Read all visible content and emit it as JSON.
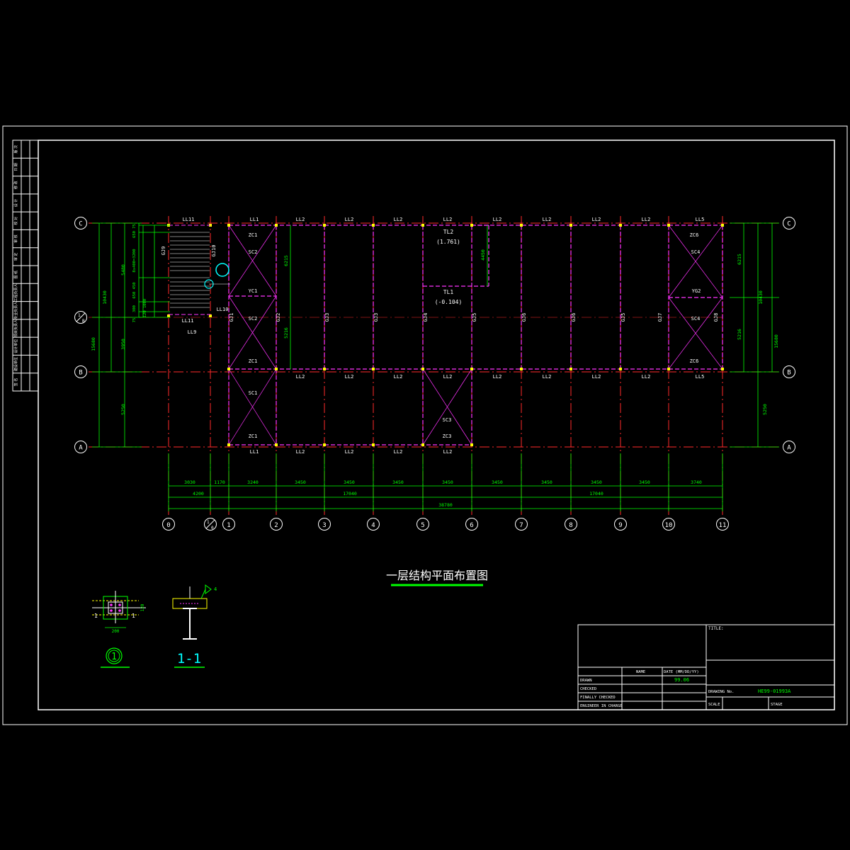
{
  "drawing_title": "一层结构平面布置图",
  "grid_rows": [
    "C",
    "B",
    "A"
  ],
  "grid_row_aux": {
    "num": "1",
    "den": "B"
  },
  "grid_cols": [
    "0",
    "1",
    "2",
    "3",
    "4",
    "5",
    "6",
    "7",
    "8",
    "9",
    "10",
    "11"
  ],
  "grid_col_aux": {
    "num": "1",
    "den": "0"
  },
  "beams_top": [
    "LL11",
    "LL1",
    "LL2",
    "LL2",
    "LL2",
    "LL2",
    "LL2",
    "LL2",
    "LL2",
    "LL2",
    "LL5"
  ],
  "beams_mid": [
    "LL2",
    "LL2",
    "LL2",
    "LL2",
    "LL2",
    "LL2",
    "LL2",
    "LL2",
    "LL5"
  ],
  "beams_bot": [
    "LL1",
    "LL2",
    "LL2",
    "LL2",
    "LL2"
  ],
  "beams_stair": [
    "LL11",
    "LL9",
    "LL10"
  ],
  "frames": [
    "GJ1",
    "GJ2",
    "GJ3",
    "GJ3",
    "GJ4",
    "GJ5",
    "GJ6",
    "GJ6",
    "GJ5",
    "GJ7",
    "GJ8",
    "GJ9",
    "GJ10"
  ],
  "bracing": [
    "ZC1",
    "SC2",
    "YC1",
    "SC2",
    "ZC1",
    "SC1",
    "ZC1",
    "SC3",
    "ZC3",
    "ZC6",
    "SC4",
    "YG2",
    "SC4",
    "ZC6"
  ],
  "tl2": {
    "name": "TL2",
    "elev": "(1.761)"
  },
  "tl1": {
    "name": "TL1",
    "elev": "(-0.104)"
  },
  "dims_bottom_1": [
    "3030",
    "1170",
    "3240",
    "3450",
    "3450",
    "3450",
    "3450",
    "3450",
    "3450",
    "3450",
    "3450",
    "3740"
  ],
  "dims_bottom_2": [
    "4200",
    "17040",
    "17040"
  ],
  "dims_total": "38780",
  "dims_left": [
    "10430",
    "5480",
    "3950",
    "15680",
    "5250"
  ],
  "dims_right": [
    "10430",
    "15680",
    "5250",
    "6215",
    "5216"
  ],
  "dims_inner": [
    "6215",
    "5216",
    "4450",
    "6215",
    "5216"
  ],
  "stair_dims": [
    "650 75",
    "8x400=3200",
    "650 450",
    "300",
    "120 1000",
    "75"
  ],
  "detail_1": {
    "label": "1",
    "dim": "200",
    "side": "120",
    "cut": "1"
  },
  "detail_2": {
    "label": "1-1",
    "tag": "4"
  },
  "left_strip": [
    "版 次",
    "日 期",
    "修 改",
    "设 计",
    "校 对",
    "审 核",
    "审 定",
    "图 纸",
    "工程负责人",
    "专业负责人",
    "项目负责人",
    "设计单位",
    "建设单位",
    "签 名"
  ],
  "title_block": {
    "title_label": "TITLE:",
    "name_col": "NAME",
    "date_col": "DATE (MM/DD/YY)",
    "drawn": "DRAWN",
    "checked": "CHECKED",
    "finally_checked": "FINALLY CHECKED",
    "engineer": "ENGINEER IN CHARGE",
    "date_val": "99.06",
    "drawing_no_label": "DRAWING No.",
    "drawing_no": "HE99-01993A",
    "scale_label": "SCALE",
    "stage_label": "STAGE"
  },
  "colors": {
    "background": "#000000",
    "frame": "#ffffff",
    "dims": "#00ff00",
    "members": "#ff33ff",
    "axis": "#ff2a2a",
    "mark": "#ffff00",
    "cyan": "#00ffff"
  }
}
